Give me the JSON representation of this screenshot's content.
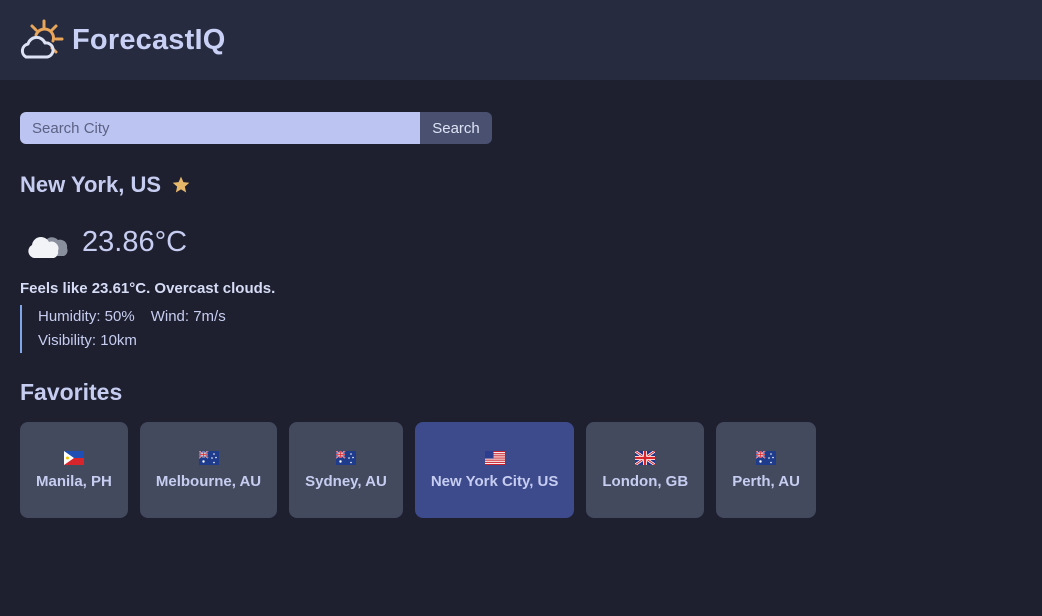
{
  "app": {
    "title": "ForecastIQ",
    "logo_icon": "sun-cloud-logo-icon"
  },
  "search": {
    "placeholder": "Search City",
    "value": "",
    "button_label": "Search"
  },
  "current": {
    "city": "New York, US",
    "favorite_icon": "star-icon",
    "weather_icon": "cloud-icon",
    "temperature": "23.86°C",
    "feels_like": "Feels like 23.61°C. Overcast clouds.",
    "humidity": "Humidity: 50%",
    "wind": "Wind: 7m/s",
    "visibility": "Visibility: 10km"
  },
  "favorites": {
    "title": "Favorites",
    "items": [
      {
        "label": "Manila, PH",
        "flag": "ph-flag-icon",
        "active": false
      },
      {
        "label": "Melbourne, AU",
        "flag": "au-flag-icon",
        "active": false
      },
      {
        "label": "Sydney, AU",
        "flag": "au-flag-icon",
        "active": false
      },
      {
        "label": "New York City, US",
        "flag": "us-flag-icon",
        "active": true
      },
      {
        "label": "London, GB",
        "flag": "gb-flag-icon",
        "active": false
      },
      {
        "label": "Perth, AU",
        "flag": "au-flag-icon",
        "active": false
      }
    ]
  },
  "colors": {
    "background": "#1e1f2f",
    "header": "#262b3f",
    "accent": "#bcc4f2",
    "star": "#e8b86a",
    "card": "#434a5e",
    "card_active": "#3d4a8c"
  }
}
